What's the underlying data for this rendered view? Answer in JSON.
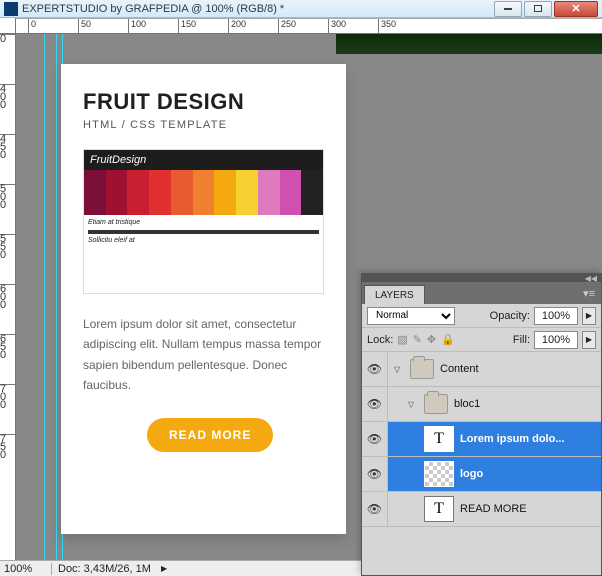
{
  "window": {
    "title": "EXPERTSTUDIO by GRAFPEDIA @ 100% (RGB/8) *"
  },
  "ruler": {
    "h": [
      "0",
      "50",
      "100",
      "150",
      "200",
      "250",
      "300",
      "350"
    ],
    "v": [
      "0",
      "4",
      "0",
      "0",
      "4",
      "5",
      "0",
      "5",
      "0",
      "0",
      "5",
      "5",
      "0",
      "6",
      "0",
      "0",
      "6",
      "5",
      "0",
      "7",
      "0",
      "0",
      "7",
      "5",
      "0"
    ]
  },
  "card": {
    "title": "FRUIT DESIGN",
    "subtitle": "HTML / CSS TEMPLATE",
    "thumb_title": "FruitDesign",
    "lorem": "Lorem ipsum dolor sit amet, consectetur adipiscing elit. Nullam tempus massa tempor sapien bibendum pellentesque. Donec faucibus.",
    "button": "READ MORE"
  },
  "statusbar": {
    "zoom": "100%",
    "doc": "Doc: 3,43M/26, 1M"
  },
  "layers": {
    "tab": "LAYERS",
    "blend_label": "Normal",
    "opacity_label": "Opacity:",
    "opacity_value": "100%",
    "lock_label": "Lock:",
    "fill_label": "Fill:",
    "fill_value": "100%",
    "items": [
      {
        "name": "Content"
      },
      {
        "name": "bloc1"
      },
      {
        "name": "Lorem ipsum dolo..."
      },
      {
        "name": "logo"
      },
      {
        "name": "READ MORE"
      }
    ]
  }
}
